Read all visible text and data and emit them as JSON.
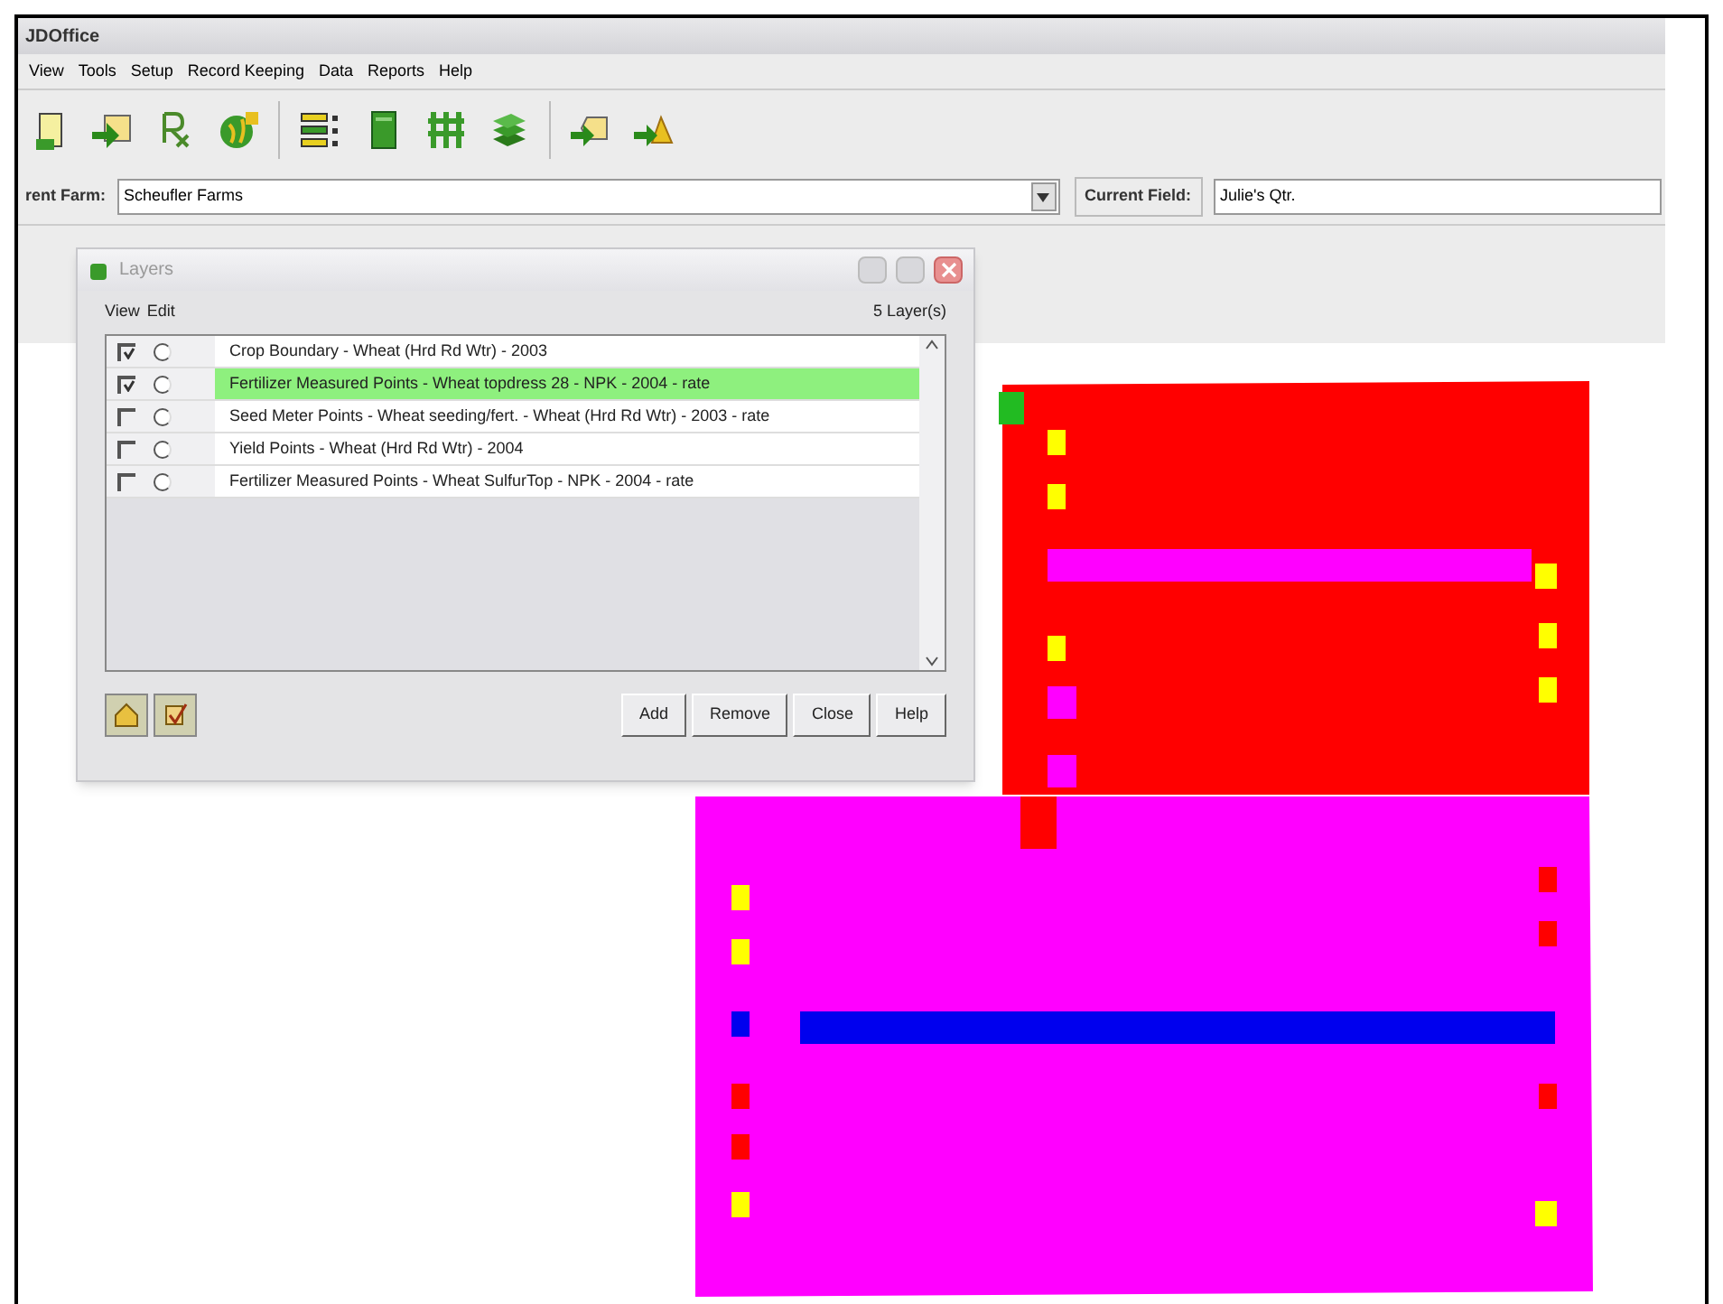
{
  "window": {
    "title": "JDOffice"
  },
  "menu": [
    "View",
    "Tools",
    "Setup",
    "Record Keeping",
    "Data",
    "Reports",
    "Help"
  ],
  "farm_bar": {
    "farm_label": "rent Farm:",
    "farm_value": "Scheufler Farms",
    "field_label": "Current Field:",
    "field_value": "Julie's Qtr."
  },
  "layers_dialog": {
    "title": "Layers",
    "column_headers": [
      "View",
      "Edit"
    ],
    "count": "5 Layer(s)",
    "layers": [
      {
        "name": "Crop Boundary - Wheat (Hrd Rd Wtr) - 2003",
        "view": true,
        "edit": false,
        "selected": false
      },
      {
        "name": "Fertilizer Measured Points - Wheat topdress 28 - NPK - 2004 - rate",
        "view": true,
        "edit": false,
        "selected": true
      },
      {
        "name": "Seed Meter Points - Wheat seeding/fert. - Wheat (Hrd Rd Wtr) - 2003 - rate",
        "view": false,
        "edit": false,
        "selected": false
      },
      {
        "name": "Yield Points - Wheat (Hrd Rd Wtr) - 2004",
        "view": false,
        "edit": false,
        "selected": false
      },
      {
        "name": "Fertilizer Measured Points - Wheat SulfurTop - NPK - 2004 - rate",
        "view": false,
        "edit": false,
        "selected": false
      }
    ],
    "buttons": [
      "Add",
      "Remove",
      "Close",
      "Help"
    ]
  }
}
